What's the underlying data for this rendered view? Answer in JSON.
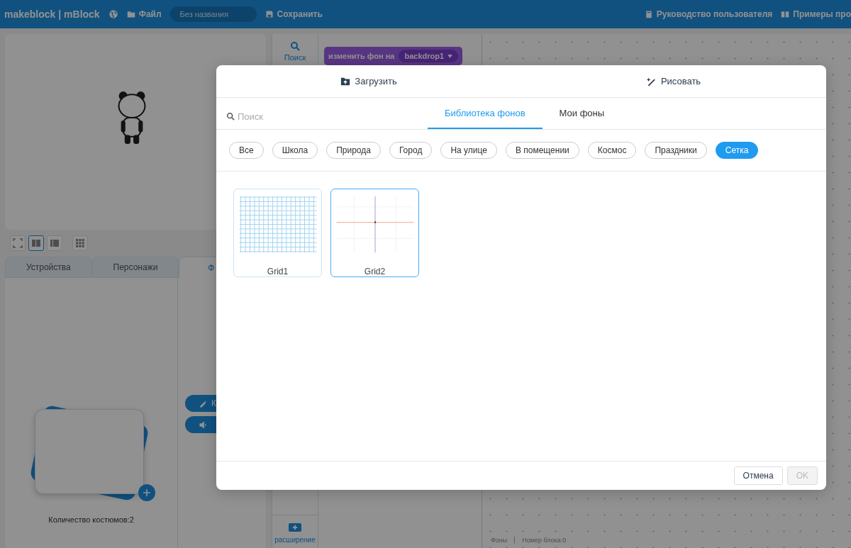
{
  "header": {
    "logo": "makeblock | mBlock",
    "file_menu": "Файл",
    "project_name": "Без названия",
    "save": "Сохранить",
    "user_guide": "Руководство пользователя",
    "examples": "Примеры про"
  },
  "stage": {
    "view_modes": [
      {
        "kind": "fullscreen",
        "selected": false
      },
      {
        "kind": "large",
        "selected": true
      },
      {
        "kind": "small",
        "selected": false
      },
      {
        "kind": "grid",
        "selected": false
      }
    ]
  },
  "panel_tabs": [
    {
      "label": "Устройства",
      "selected": false
    },
    {
      "label": "Персонажи",
      "selected": false
    },
    {
      "label": "Ф",
      "selected": true
    }
  ],
  "costumes": {
    "count_label": "Количество костюмов:2"
  },
  "side_buttons": [
    {
      "kind": "paint",
      "label": "К"
    },
    {
      "kind": "sound"
    }
  ],
  "categories": {
    "search": "Поиск",
    "extension": "расширение"
  },
  "block": {
    "text": "изменить фон на",
    "value": "backdrop1"
  },
  "canvas_footer": [
    "Фоны",
    "Номер блока:0"
  ],
  "dialog": {
    "actions": [
      {
        "kind": "upload",
        "label": "Загрузить"
      },
      {
        "kind": "paint",
        "label": "Рисовать"
      }
    ],
    "search": {
      "placeholder": "Поиск"
    },
    "tabs": [
      {
        "label": "Библиотека фонов",
        "selected": true
      },
      {
        "label": "Мои фоны",
        "selected": false
      }
    ],
    "filters": [
      {
        "label": "Все",
        "selected": false
      },
      {
        "label": "Школа",
        "selected": false
      },
      {
        "label": "Природа",
        "selected": false
      },
      {
        "label": "Город",
        "selected": false
      },
      {
        "label": "На улице",
        "selected": false
      },
      {
        "label": "В помещении",
        "selected": false
      },
      {
        "label": "Космос",
        "selected": false
      },
      {
        "label": "Праздники",
        "selected": false
      },
      {
        "label": "Сетка",
        "selected": true
      }
    ],
    "items": [
      {
        "name": "Grid1",
        "kind": "square-grid",
        "selected": false
      },
      {
        "name": "Grid2",
        "kind": "axes",
        "selected": true
      }
    ],
    "buttons": [
      {
        "label": "Отмена",
        "disabled": false
      },
      {
        "label": "OK",
        "disabled": true
      }
    ]
  }
}
